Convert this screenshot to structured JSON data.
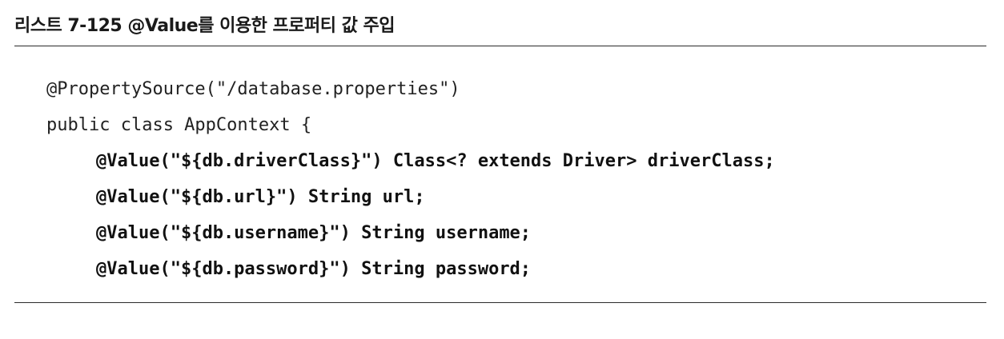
{
  "listing": {
    "caption": "리스트 7-125 @Value를 이용한 프로퍼티 값 주입",
    "code_lines": [
      "@PropertySource(\"/database.properties\")",
      "public class AppContext {",
      "@Value(\"${db.driverClass}\") Class<? extends Driver> driverClass;",
      "@Value(\"${db.url}\") String url;",
      "@Value(\"${db.username}\") String username;",
      "@Value(\"${db.password}\") String password;"
    ]
  }
}
